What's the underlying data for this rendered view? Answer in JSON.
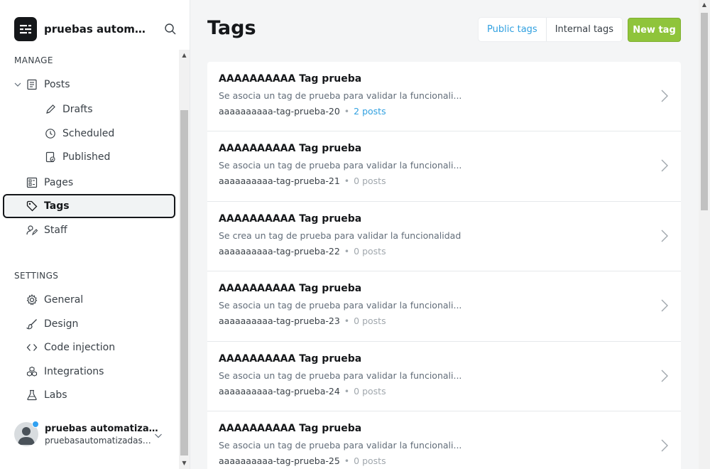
{
  "site": {
    "title": "pruebas automatizadas",
    "logo_icon": "ghost-logo-icon",
    "search_icon": "search-icon"
  },
  "nav": {
    "manage_label": "MANAGE",
    "settings_label": "SETTINGS",
    "items": {
      "posts": "Posts",
      "drafts": "Drafts",
      "scheduled": "Scheduled",
      "published": "Published",
      "pages": "Pages",
      "tags": "Tags",
      "staff": "Staff",
      "general": "General",
      "design": "Design",
      "code_injection": "Code injection",
      "integrations": "Integrations",
      "labs": "Labs"
    },
    "active": "Tags"
  },
  "user": {
    "name": "pruebas automatizadas",
    "email": "pruebasautomatizadas@uniandes.edu.co"
  },
  "main": {
    "title": "Tags",
    "segment": {
      "public": "Public tags",
      "internal": "Internal tags",
      "active": "public"
    },
    "new_tag_label": "New tag"
  },
  "tags": [
    {
      "name": "AAAAAAAAAA Tag prueba",
      "description": "Se asocia un tag de prueba para validar la funcionali...",
      "slug": "aaaaaaaaaa-tag-prueba-20",
      "count": "2 posts",
      "linked": true
    },
    {
      "name": "AAAAAAAAAA Tag prueba",
      "description": "Se asocia un tag de prueba para validar la funcionali...",
      "slug": "aaaaaaaaaa-tag-prueba-21",
      "count": "0 posts",
      "linked": false
    },
    {
      "name": "AAAAAAAAAA Tag prueba",
      "description": "Se crea un tag de prueba para validar la funcionalidad",
      "slug": "aaaaaaaaaa-tag-prueba-22",
      "count": "0 posts",
      "linked": false
    },
    {
      "name": "AAAAAAAAAA Tag prueba",
      "description": "Se asocia un tag de prueba para validar la funcionali...",
      "slug": "aaaaaaaaaa-tag-prueba-23",
      "count": "0 posts",
      "linked": false
    },
    {
      "name": "AAAAAAAAAA Tag prueba",
      "description": "Se asocia un tag de prueba para validar la funcionali...",
      "slug": "aaaaaaaaaa-tag-prueba-24",
      "count": "0 posts",
      "linked": false
    },
    {
      "name": "AAAAAAAAAA Tag prueba",
      "description": "Se asocia un tag de prueba para validar la funcionali...",
      "slug": "aaaaaaaaaa-tag-prueba-25",
      "count": "0 posts",
      "linked": false
    }
  ],
  "colors": {
    "accent": "#30a0e0",
    "primary_button": "#8fc43b",
    "text": "#15171a",
    "muted": "#626d79"
  }
}
